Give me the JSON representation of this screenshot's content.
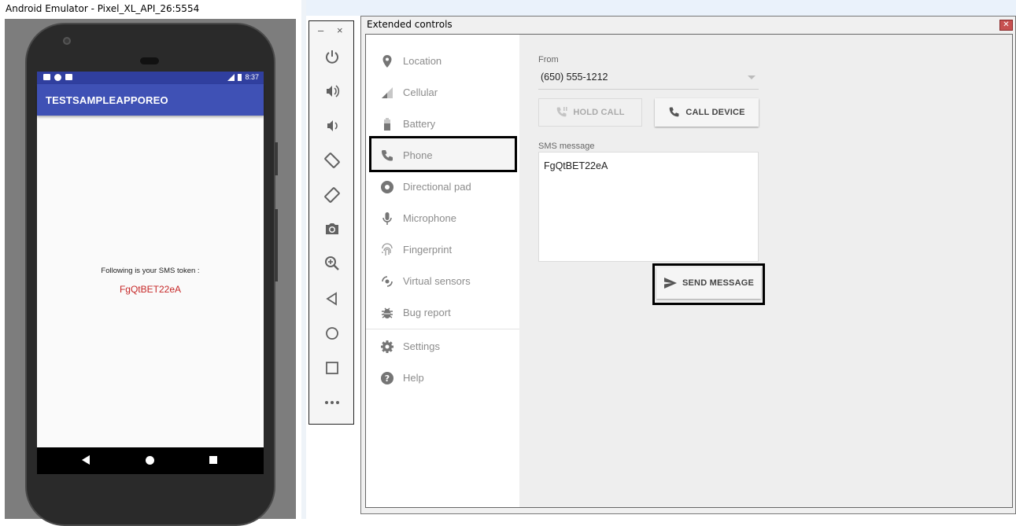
{
  "emulator": {
    "window_title": "Android Emulator - Pixel_XL_API_26:5554",
    "status_time": "8:37",
    "app_title": "TESTSAMPLEAPPOREO",
    "sms_label": "Following is your SMS token :",
    "sms_token": "FgQtBET22eA"
  },
  "toolbar": {
    "minimize": "–",
    "close": "×",
    "items": [
      "power",
      "volume-up",
      "volume-down",
      "rotate-left",
      "rotate-right",
      "screenshot",
      "zoom",
      "back",
      "home",
      "overview",
      "more"
    ]
  },
  "extended": {
    "window_title": "Extended controls",
    "close": "✕",
    "sidebar": [
      {
        "label": "Location",
        "icon": "location-pin-icon"
      },
      {
        "label": "Cellular",
        "icon": "signal-icon"
      },
      {
        "label": "Battery",
        "icon": "battery-icon"
      },
      {
        "label": "Phone",
        "icon": "phone-icon"
      },
      {
        "label": "Directional pad",
        "icon": "dpad-icon"
      },
      {
        "label": "Microphone",
        "icon": "microphone-icon"
      },
      {
        "label": "Fingerprint",
        "icon": "fingerprint-icon"
      },
      {
        "label": "Virtual sensors",
        "icon": "sensors-icon"
      },
      {
        "label": "Bug report",
        "icon": "bug-icon"
      },
      {
        "label": "Settings",
        "icon": "gear-icon"
      },
      {
        "label": "Help",
        "icon": "help-icon"
      }
    ],
    "selected": "Phone",
    "phone": {
      "from_label": "From",
      "from_value": "(650) 555-1212",
      "hold_call": "HOLD CALL",
      "call_device": "CALL DEVICE",
      "sms_label": "SMS message",
      "sms_text": "FgQtBET22eA",
      "send_message": "SEND MESSAGE"
    }
  },
  "colors": {
    "app_bar": "#3f51b5",
    "status_bar": "#303f9f",
    "token": "#c62828",
    "sidebar_text": "#8c8c8c"
  }
}
